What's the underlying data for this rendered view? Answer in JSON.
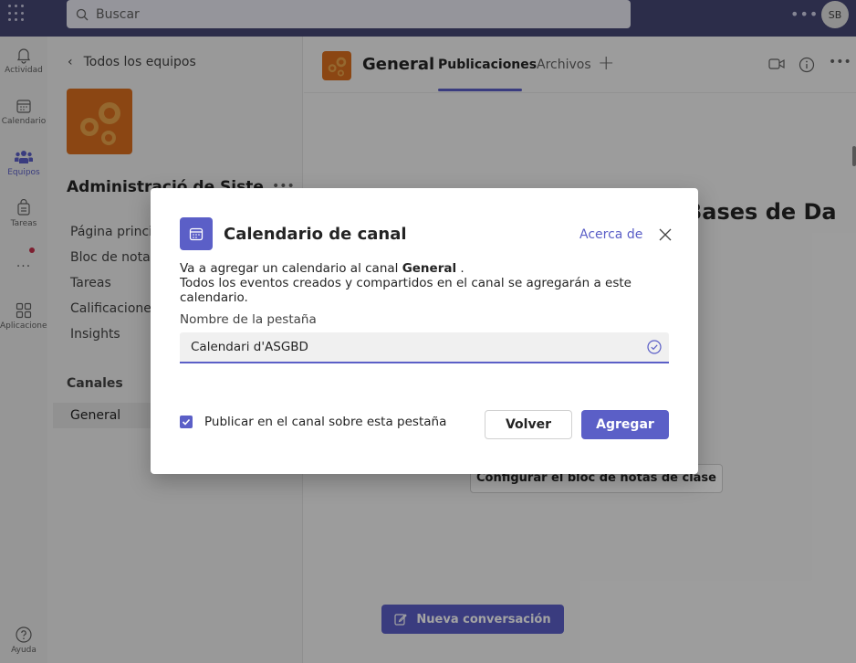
{
  "topbar": {
    "search_placeholder": "Buscar",
    "more_icon": "more-horizontal-icon",
    "avatar_initials": "SB"
  },
  "rail": {
    "items": [
      {
        "label": "Actividad",
        "icon": "bell-icon"
      },
      {
        "label": "Calendario",
        "icon": "calendar-icon"
      },
      {
        "label": "Equipos",
        "icon": "teams-icon"
      },
      {
        "label": "Tareas",
        "icon": "tasks-icon"
      },
      {
        "label": "Aplicaciones",
        "icon": "apps-icon"
      },
      {
        "label": "Ayuda",
        "icon": "help-icon"
      }
    ],
    "more_label": "..."
  },
  "team_panel": {
    "back_label": "Todos los equipos",
    "team_name": "Administració de Siste",
    "links": [
      "Página principal",
      "Bloc de notas",
      "Tareas",
      "Calificaciones",
      "Insights"
    ],
    "channels_heading": "Canales",
    "channel_general": "General"
  },
  "header": {
    "channel_title": "General",
    "tabs": [
      "Publicaciones",
      "Archivos"
    ],
    "active_tab": "Publicaciones"
  },
  "main": {
    "heading_fragment": "Bases de Da",
    "notebook_button": "Configurar el bloc de notas de clase",
    "new_conversation_button": "Nueva conversación"
  },
  "dialog": {
    "title": "Calendario de canal",
    "about_link": "Acerca de",
    "desc_line1_prefix": "Va a agregar un calendario al canal ",
    "desc_channel": "General",
    "desc_line1_suffix": " .",
    "desc_line2": "Todos los eventos creados y compartidos en el canal se agregarán a este calendario.",
    "field_label": "Nombre de la pestaña",
    "field_value": "Calendari d'ASGBD",
    "post_checkbox_label": "Publicar en el canal sobre esta pestaña",
    "post_checkbox_checked": true,
    "back_button": "Volver",
    "add_button": "Agregar"
  },
  "colors": {
    "accent": "#5b5fc7",
    "topbar": "#464775",
    "team_orange": "#d96e1f"
  }
}
